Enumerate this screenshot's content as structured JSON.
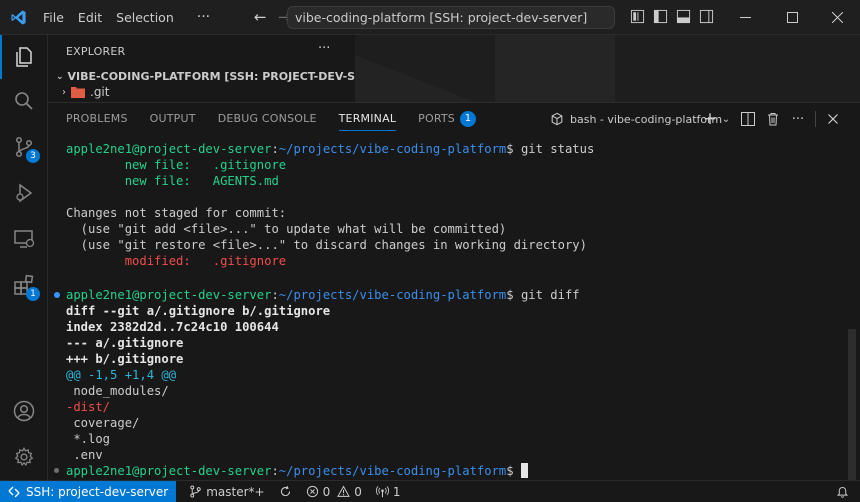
{
  "titlebar": {
    "menu": [
      "File",
      "Edit",
      "Selection"
    ],
    "more": "···",
    "command_center": "vibe-coding-platform [SSH: project-dev-server]"
  },
  "activity_bar": {
    "scm_badge": "3",
    "extensions_badge": "1"
  },
  "explorer": {
    "title": "EXPLORER",
    "more": "···",
    "folder": "VIBE-CODING-PLATFORM [SSH: PROJECT-DEV-SERVER]",
    "items": [
      ".git"
    ]
  },
  "panel": {
    "tabs": [
      {
        "label": "PROBLEMS"
      },
      {
        "label": "OUTPUT"
      },
      {
        "label": "DEBUG CONSOLE"
      },
      {
        "label": "TERMINAL",
        "active": true
      },
      {
        "label": "PORTS",
        "badge": "1"
      }
    ],
    "terminal_instance": "bash - vibe-coding-platform"
  },
  "terminal": {
    "prompt_user": "apple2ne1@project-dev-server",
    "prompt_sep": ":",
    "prompt_path": "~/projects/vibe-coding-platform",
    "prompt_end": "$",
    "cmd1": " git status",
    "new1_label": "        new file:   ",
    "new1_file": ".gitignore",
    "new2_label": "        new file:   ",
    "new2_file": "AGENTS.md",
    "not_staged": "Changes not staged for commit:",
    "hint1": "  (use \"git add <file>...\" to update what will be committed)",
    "hint2": "  (use \"git restore <file>...\" to discard changes in working directory)",
    "mod_label": "        modified:   ",
    "mod_file": ".gitignore",
    "cmd2": " git diff",
    "diff_header": "diff --git a/.gitignore b/.gitignore",
    "index_line": "index 2382d2d..7c24c10 100644",
    "minus_file": "--- a/.gitignore",
    "plus_file": "+++ b/.gitignore",
    "hunk": "@@ -1,5 +1,4 @@",
    "ctx1": " node_modules/",
    "removed": "-dist/",
    "ctx2": " coverage/",
    "ctx3": " *.log",
    "ctx4": " .env"
  },
  "statusbar": {
    "remote": "SSH: project-dev-server",
    "branch": "master*+",
    "errors": "0",
    "warnings": "0",
    "ports": "1"
  },
  "colors": {
    "accent": "#0078d4",
    "terminal_green": "#23d18b",
    "terminal_blue": "#3b8eea",
    "terminal_red": "#f14c4c",
    "terminal_cyan": "#29b8db"
  }
}
